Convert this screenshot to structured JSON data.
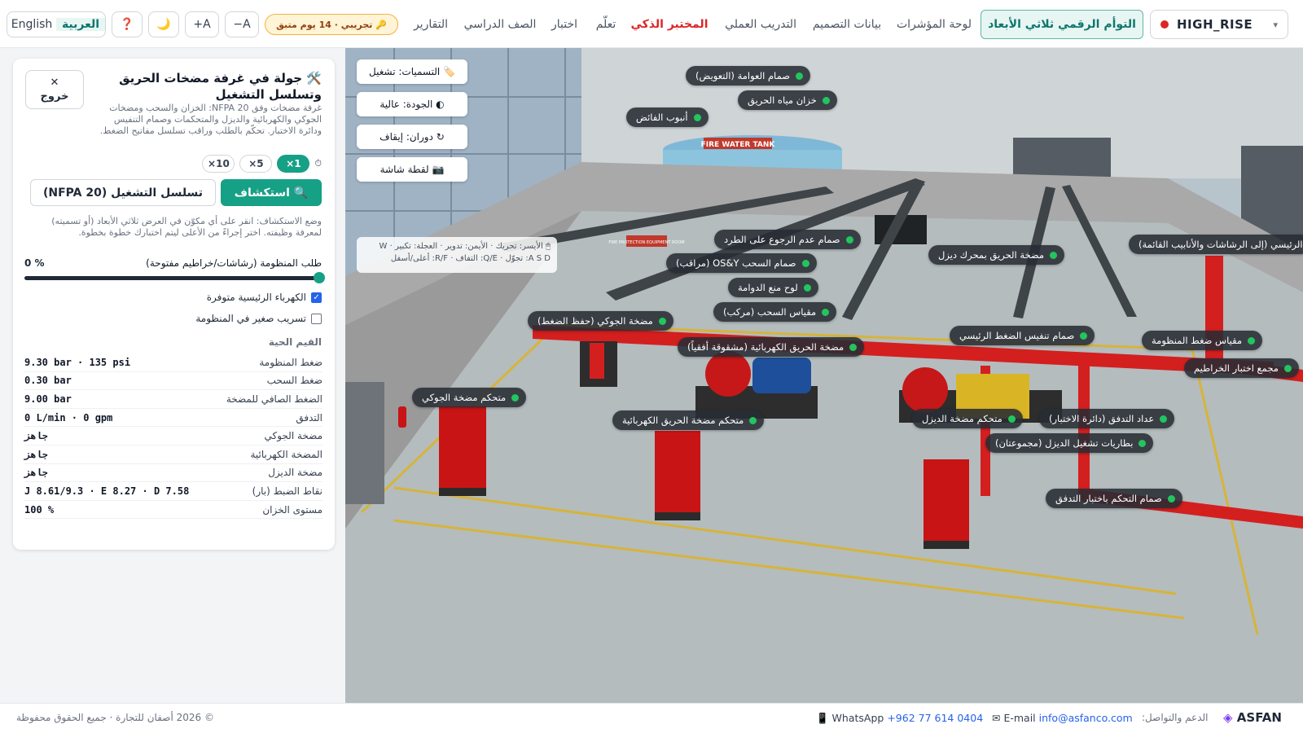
{
  "nav": {
    "scene": "HIGH_RISE",
    "twin_tab": "التوأم الرقمي ثلاثي الأبعاد",
    "links": [
      "لوحة المؤشرات",
      "بيانات التصميم",
      "التدريب العملي",
      "المختبر الذكي",
      "تعلّم",
      "اختبار",
      "الصف الدراسي",
      "التقارير"
    ],
    "trial_badge": "🔑 تجريبي · 14 يوم متبق",
    "font_minus": "A−",
    "font_plus": "A+",
    "theme_icon": "🌙",
    "help_icon": "❓",
    "lang_en": "English",
    "lang_ar": "العربية"
  },
  "panel": {
    "title": "🛠️ جولة في غرفة مضخات الحريق وتسلسل التشغيل",
    "exit_icon": "✕",
    "exit_label": "خروج",
    "description": "غرفة مضخات وفق NFPA 20: الخزان والسحب ومضخات الجوكي والكهربائية والديزل والمتحكمات وصمام التنفيس ودائرة الاختبار. تحكّم بالطلب وراقب تسلسل مفاتيح الضغط.",
    "speed_icon": "⏱",
    "speeds": [
      "1×",
      "5×",
      "10×"
    ],
    "explore_btn": "🔍 استكشاف",
    "sequence_btn": "تسلسل التشغيل (NFPA 20)",
    "hint": "وضع الاستكشاف: انقر على أي مكوّن في العرض ثلاثي الأبعاد (أو تسميته) لمعرفة وظيفته. اختر إجراءً من الأعلى ليتم اختبارك خطوة بخطوة.",
    "demand_label": "طلب المنظومة (رشاشات/خراطيم مفتوحة)",
    "demand_value": "0 %",
    "demand_fraction": 0,
    "check_power": "الكهرباء الرئيسية متوفرة",
    "check_power_on": true,
    "check_leak": "تسريب صغير في المنظومة",
    "check_leak_on": false,
    "live_heading": "القيم الحية",
    "live": [
      {
        "k": "ضغط المنظومة",
        "v": "9.30 bar · 135 psi"
      },
      {
        "k": "ضغط السحب",
        "v": "0.30 bar"
      },
      {
        "k": "الضغط الصافي للمضخة",
        "v": "9.00 bar"
      },
      {
        "k": "التدفق",
        "v": "0 L/min · 0 gpm"
      },
      {
        "k": "مضخة الجوكي",
        "v": "جاهز"
      },
      {
        "k": "المضخة الكهربائية",
        "v": "جاهز"
      },
      {
        "k": "مضخة الديزل",
        "v": "جاهز"
      },
      {
        "k": "نقاط الضبط (بار)",
        "v": "J 8.61/9.3 · E 8.27 · D 7.58"
      },
      {
        "k": "مستوى الخزان",
        "v": "100 %"
      }
    ]
  },
  "viewport": {
    "buttons": [
      "🏷️ التسميات: تشغيل",
      "◐ الجودة: عالية",
      "↻ دوران: إيقاف",
      "📷 لقطة شاشة"
    ],
    "controls_hint_1": "🖱 الأيسر: تحريك · الأيمن: تدوير · العجلة: تكبير · W",
    "controls_hint_2": "A S D: تجوّل · Q/E: التفاف · R/F: أعلى/أسفل",
    "tank_sign": "FIRE WATER TANK",
    "wall_sign": "FIRE PROTECTION EQUIPMENT ROOM",
    "labels": [
      "صمام العوامة (التعويض)",
      "خزان مياه الحريق",
      "أنبوب الفائض",
      "صمام عدم الرجوع على الطرد",
      "الرئيسي (إلى الرشاشات والأنابيب القائمة)",
      "صمام السحب OS&Y (مراقب)",
      "مضخة الحريق بمحرك ديزل",
      "لوح منع الدوامة",
      "مقياس السحب (مركب)",
      "مضخة الجوكي (حفظ الضغط)",
      "صمام تنفيس الضغط الرئيسي",
      "مقياس ضغط المنظومة",
      "مضخة الحريق الكهربائية (مشقوقة أفقياً)",
      "مجمع اختبار الخراطيم",
      "متحكم مضخة الجوكي",
      "متحكم مضخة الحريق الكهربائية",
      "متحكم مضخة الديزل",
      "عداد التدفق (دائرة الاختبار)",
      "بطاريات تشغيل الديزل (مجموعتان)",
      "صمام التحكم باختبار التدفق"
    ]
  },
  "footer": {
    "brand": "ASFAN",
    "support_label": "الدعم والتواصل:",
    "email_label": "✉ E-mail",
    "email": "info@asfanco.com",
    "whatsapp_label": "📱 WhatsApp",
    "whatsapp": "+962 77 614 0404",
    "copyright": "© 2026 أصفان للتجارة · جميع الحقوق محفوظة"
  }
}
